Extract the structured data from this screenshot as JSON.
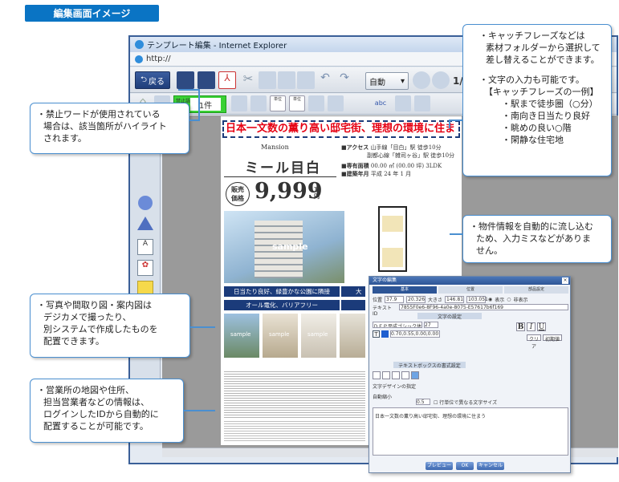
{
  "tag_label": "編集画面イメージ",
  "window": {
    "title": "テンプレート編集 - Internet Explorer",
    "address": "http://"
  },
  "toolbar": {
    "back_label": "戻る",
    "zoom_select": "自動",
    "page_indicator": "1/1",
    "forbidden_label": "禁止語句",
    "forbidden_count": "1件",
    "format_label": "abc",
    "tool_label_a": "単位",
    "tool_label_b": "単位"
  },
  "flyer": {
    "headline": "日本一文数の薫り高い邸宅街、理想の環境に住ま",
    "mansion_label": "Mansion",
    "mansion_name": "ミール目白",
    "access_label": "■アクセス",
    "access_line1": "山手線「目白」駅 徒歩10分",
    "access_line2": "副都心線「雑司ヶ谷」駅 徒歩10分",
    "area_label": "■専有面積",
    "area_value": "00.00 ㎡ (00.00 坪)  3LDK",
    "built_label": "■建築年月",
    "built_value": "平成 24 年 1 月",
    "price_badge_top": "販売",
    "price_badge_bottom": "価格",
    "price_value": "9,999",
    "price_unit": "万円",
    "sample_label": "sample",
    "band1": "日当たり良好、緑豊かな公園に隣接",
    "band2": "オール電化、バリアフリー",
    "band1_right": "大",
    "sample_small": "sample"
  },
  "dialog": {
    "title": "文字の編集",
    "tab1": "基本",
    "tab2": "位置",
    "tab3": "部品設定",
    "row_pos_label": "位置",
    "x_val": "37.9",
    "y_val": "20.326",
    "size_label": "大きさ",
    "w_val": "146.81",
    "h_val": "103.051",
    "show_label": "表示",
    "hide_label": "非表示",
    "textid_label": "テキストID",
    "textid_val": "7855F0e6-8F96-4a0e-8075-E57617b6f169",
    "font_section": "文字の設定",
    "font_select": "ＤＦＰ平成ゴシック体W7",
    "font_size": "27",
    "color_val": "0.70,0.55,0.00,0.00",
    "bold_label": "B",
    "italic_label": "I",
    "underline_label": "U",
    "clear_label": "クリア",
    "reset_label": "初期値",
    "box_section": "テキストボックスの書式設定",
    "design_label": "文字デザインの指定",
    "reduce_label": "自動縮小",
    "ratio_val": "0.5",
    "chk_label": "行単位で異なる文字サイズ",
    "sample_text": "日本一文数の薫り高い邸宅街、理想の環境に住まう",
    "preview_label": "プレビュー",
    "ok_label": "OK",
    "cancel_label": "キャンセル"
  },
  "callouts": {
    "top_right": [
      "・キャッチフレーズなどは",
      "素材フォルダーから選択して",
      "差し替えることができます。"
    ],
    "input_note": "・文字の入力も可能です。",
    "catch_title": "【キャッチフレーズの一例】",
    "catch_items": [
      "・駅まで徒歩圏（○分）",
      "・南向き日当たり良好",
      "・眺めの良い○階",
      "・閑静な住宅地"
    ],
    "forbidden": [
      "・禁止ワードが使用されている",
      "場合は、該当箇所がハイライト",
      "されます。"
    ],
    "auto_info": [
      "・物件情報を自動的に流し込む",
      "ため、入力ミスなどがありま",
      "せん。"
    ],
    "photos": [
      "・写真や間取り図・案内図は",
      "デジカメで撮ったり、",
      "別システムで作成したものを",
      "配置できます。"
    ],
    "map": [
      "・営業所の地図や住所、",
      "担当営業者などの情報は、",
      "ログインしたIDから自動的に",
      "配置することが可能です。"
    ]
  },
  "colors": {
    "accent": "#0a74c4",
    "highlight": "#e60012",
    "navy": "#1b3b7a"
  }
}
